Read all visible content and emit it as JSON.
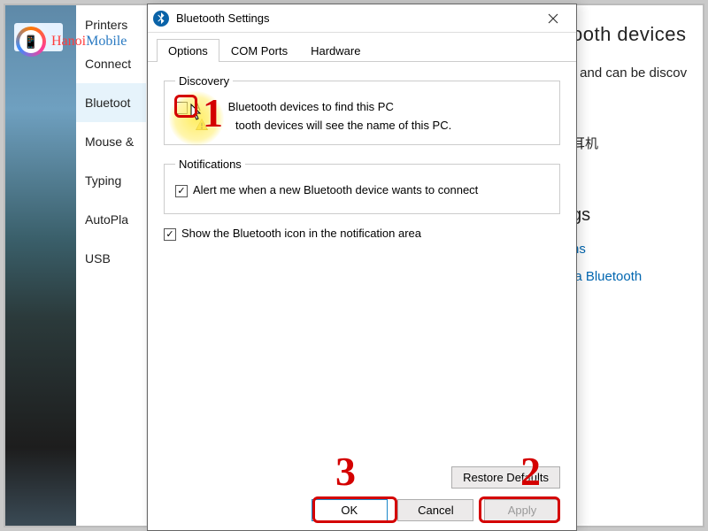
{
  "watermark": {
    "brand": "HanoiMobile"
  },
  "sidebar": {
    "items": [
      {
        "label": "Printers"
      },
      {
        "label": "Connect"
      },
      {
        "label": "Bluetoot",
        "active": true
      },
      {
        "label": "Mouse &"
      },
      {
        "label": "Typing"
      },
      {
        "label": "AutoPla"
      },
      {
        "label": "USB"
      }
    ]
  },
  "background": {
    "heading": "ooth devices",
    "paragraph": "r and can be discov",
    "device_item": "耳机",
    "section_heading": "gs",
    "link1": "ns",
    "link2": "ia Bluetooth"
  },
  "dialog": {
    "title": "Bluetooth Settings",
    "tabs": {
      "options": "Options",
      "com": "COM Ports",
      "hw": "Hardware"
    },
    "discovery": {
      "legend": "Discovery",
      "allow_label": "Bluetooth devices to find this PC",
      "allow_prefix": "A",
      "note": "tooth devices will see the name of this PC."
    },
    "notifications": {
      "legend": "Notifications",
      "alert_label": "Alert me when a new Bluetooth device wants to connect"
    },
    "show_icon_label": "Show the Bluetooth icon in the notification area",
    "buttons": {
      "restore": "Restore Defaults",
      "ok": "OK",
      "cancel": "Cancel",
      "apply": "Apply"
    }
  },
  "annotations": {
    "n1": "1",
    "n2": "2",
    "n3": "3"
  }
}
